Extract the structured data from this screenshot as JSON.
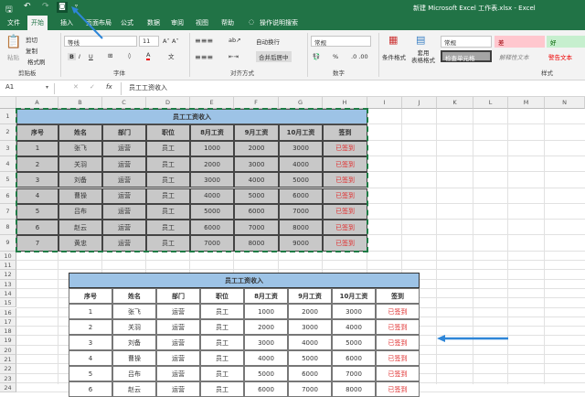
{
  "window": {
    "title": "新建 Microsoft Excel 工作表.xlsx  -  Excel"
  },
  "qat": [
    "save-icon",
    "undo-icon",
    "redo-icon",
    "camera-icon",
    "customize-icon"
  ],
  "tabs": [
    "文件",
    "开始",
    "插入",
    "页面布局",
    "公式",
    "数据",
    "审阅",
    "视图",
    "帮助"
  ],
  "active_tab": "开始",
  "search_label": "操作说明搜索",
  "ribbon": {
    "clipboard": {
      "paste": "粘贴",
      "cut": "剪切",
      "copy": "复制",
      "format_painter": "格式刷",
      "label": "剪贴板"
    },
    "font": {
      "name": "等线",
      "size": "11",
      "bold": "B",
      "italic": "I",
      "underline": "U",
      "label": "字体"
    },
    "alignment": {
      "wrap": "自动换行",
      "merge": "合并后居中",
      "label": "对齐方式"
    },
    "number": {
      "format": "常规",
      "percent": "%",
      "label": "数字"
    },
    "styles": {
      "conditional": "条件格式",
      "table": "套用\n表格格式",
      "normal": "常规",
      "bad": "差",
      "good": "好",
      "check": "检查单元格",
      "explanatory": "解释性文本",
      "warning": "警告文本",
      "label": "样式"
    }
  },
  "formula_bar": {
    "name_box": "A1",
    "fx": "fx",
    "content": "员工工资收入"
  },
  "columns": [
    "A",
    "B",
    "C",
    "D",
    "E",
    "F",
    "G",
    "H",
    "I",
    "J",
    "K",
    "L",
    "M",
    "N"
  ],
  "rows": [
    "1",
    "2",
    "3",
    "4",
    "5",
    "6",
    "7",
    "8",
    "9",
    "10",
    "11",
    "12",
    "13",
    "14",
    "15",
    "16",
    "17",
    "18",
    "19",
    "20",
    "21",
    "22",
    "23",
    "24"
  ],
  "table": {
    "title": "员工工资收入",
    "headers": [
      "序号",
      "姓名",
      "部门",
      "职位",
      "8月工资",
      "9月工资",
      "10月工资",
      "签到"
    ],
    "rows": [
      [
        "1",
        "张飞",
        "运营",
        "员工",
        "1000",
        "2000",
        "3000",
        "已签到"
      ],
      [
        "2",
        "关羽",
        "运营",
        "员工",
        "2000",
        "3000",
        "4000",
        "已签到"
      ],
      [
        "3",
        "刘备",
        "运营",
        "员工",
        "3000",
        "4000",
        "5000",
        "已签到"
      ],
      [
        "4",
        "曹操",
        "运营",
        "员工",
        "4000",
        "5000",
        "6000",
        "已签到"
      ],
      [
        "5",
        "吕布",
        "运营",
        "员工",
        "5000",
        "6000",
        "7000",
        "已签到"
      ],
      [
        "6",
        "赵云",
        "运营",
        "员工",
        "6000",
        "7000",
        "8000",
        "已签到"
      ],
      [
        "7",
        "黄忠",
        "运营",
        "员工",
        "7000",
        "8000",
        "9000",
        "已签到"
      ]
    ]
  },
  "picture_visible_rows": 6,
  "colors": {
    "excel_green": "#217346",
    "title_fill": "#9dc3e6",
    "cell_fill": "#c8c8c8",
    "signed_red": "#e03030",
    "arrow_blue": "#2e86d8",
    "copy_border": "#1e7b45"
  }
}
